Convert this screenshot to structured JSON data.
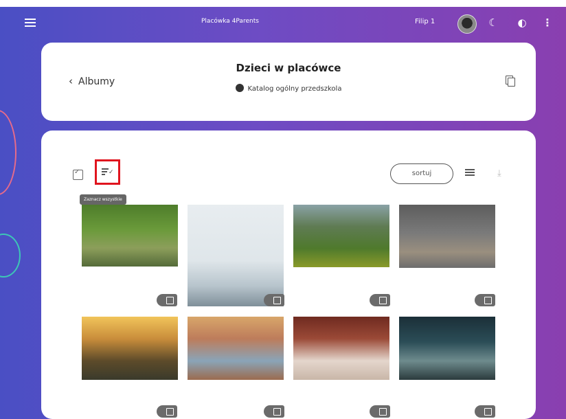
{
  "app": {
    "title": "Placówka 4Parents",
    "user_name": "Filip 1",
    "icons": [
      "menu-icon",
      "avatar",
      "moon-icon",
      "contrast-icon",
      "more-vert-icon"
    ]
  },
  "header": {
    "back_label": "Albumy",
    "album_title": "Dzieci w placówce",
    "album_subtitle": "Katalog ogólny przedszkola"
  },
  "toolbar": {
    "tooltip": "Zaznacz wszystkie",
    "sort_label": "sortuj"
  },
  "photos": [
    {
      "description": "children by pond"
    },
    {
      "description": "misty landscape with kids"
    },
    {
      "description": "children with cameras in meadow"
    },
    {
      "description": "two girls on pier"
    },
    {
      "description": "children at sunset"
    },
    {
      "description": "kids with laptop"
    },
    {
      "description": "child writing"
    },
    {
      "description": "two kids in forest"
    }
  ],
  "colors": {
    "accent": "#6d4cc4",
    "highlight_border": "#e0141e",
    "toggle": "#6b6b6b"
  }
}
